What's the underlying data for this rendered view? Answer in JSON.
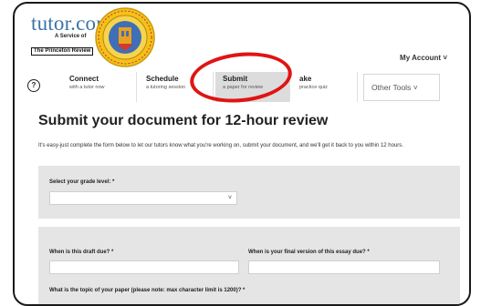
{
  "brand": {
    "name": "tutor.com",
    "sub": "A Service of",
    "partner": "The Princeton Review"
  },
  "seal": {
    "alt_icon": "lausd-seal-logo"
  },
  "account": {
    "label": "My Account",
    "caret": "˅"
  },
  "nav": {
    "help_icon": "?",
    "tabs": [
      {
        "title": "Connect",
        "subtitle": "with a tutor now"
      },
      {
        "title": "Schedule",
        "subtitle": "a tutoring session"
      },
      {
        "title": "Submit",
        "subtitle": "a paper for review",
        "active": true
      },
      {
        "title": "ake",
        "subtitle": "practice quiz"
      },
      {
        "title": "Other Tools",
        "caret": "˅"
      }
    ]
  },
  "page": {
    "heading": "Submit your document for 12-hour review",
    "intro": "It's easy-just complete the form below to let our tutors know what you're working on, submit your document, and we'll get it back to you within 12 hours."
  },
  "form": {
    "grade_label": "Select your grade level: *",
    "grade_value": "",
    "draft_due_label": "When is this draft due? *",
    "final_due_label": "When is your final version of this essay due? *",
    "topic_label": "What is the topic of your paper (please note: max character limit is 1200)? *"
  },
  "colors": {
    "accent_red": "#e01414",
    "brand_blue": "#3b74a8",
    "panel_gray": "#e5e5e5"
  }
}
